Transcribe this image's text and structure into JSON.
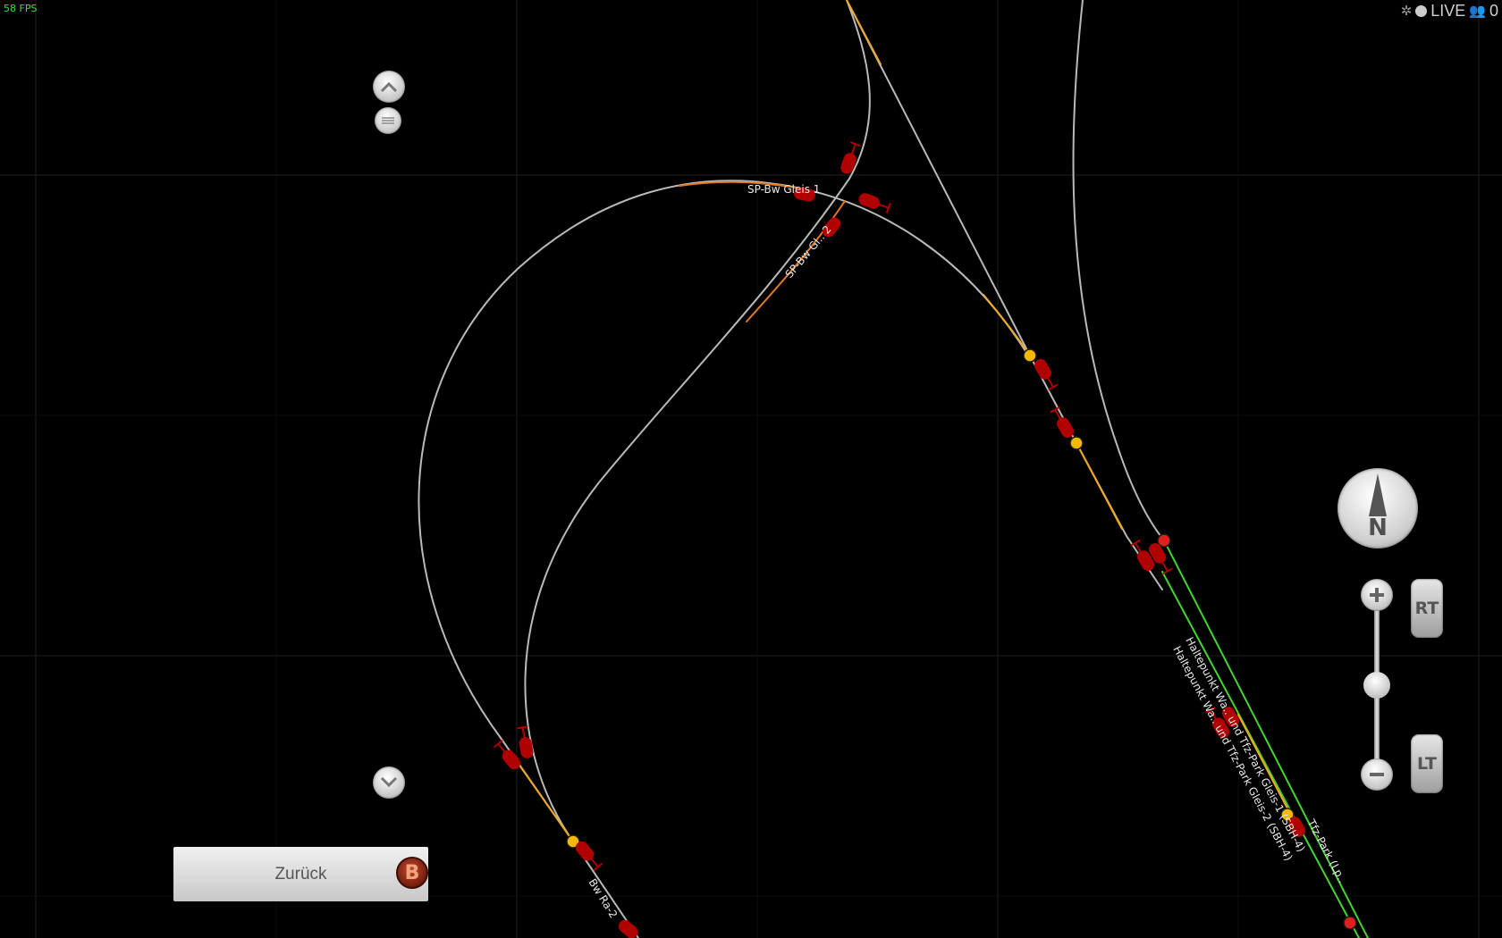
{
  "hud": {
    "fps": "58 FPS",
    "live_label": "LIVE",
    "player_count": "0"
  },
  "colors": {
    "background": "#000000",
    "track_default": "#b9b9b9",
    "track_orange": "#e5781e",
    "track_yellow": "#f0a820",
    "track_green": "#44d630",
    "signal_red": "#b00000",
    "junction_yellow": "#f5b800",
    "junction_red": "#e02020"
  },
  "track_labels": {
    "sp_bw_gleis_1": "SP-Bw Gleis 1",
    "sp_bw_gleis_2": "SP-Bw Gl.. 2",
    "bw_ra_2": "Bw Ra-2",
    "haltepunkt_gleis_1": "Haltepunkt Wa.. und Tfz-Park Gleis-1 (SBH-4)",
    "haltepunkt_gleis_2": "Haltepunkt Wa.. und Tfz-Park Gleis-2 (SBH-4)",
    "tfz_park": "Tfz-Park (Lp.."
  },
  "compass": {
    "label": "N",
    "icon": "compass-needle-icon"
  },
  "zoom": {
    "plus_icon": "plus-icon",
    "minus_icon": "minus-icon",
    "level": 0.55
  },
  "side_buttons": {
    "rt_label": "RT",
    "lt_label": "LT"
  },
  "scroll_controls": {
    "up_icon": "chevron-up-icon",
    "handle_icon": "list-handle-icon",
    "down_icon": "chevron-down-icon"
  },
  "back_button": {
    "label": "Zurück",
    "badge": "B"
  }
}
